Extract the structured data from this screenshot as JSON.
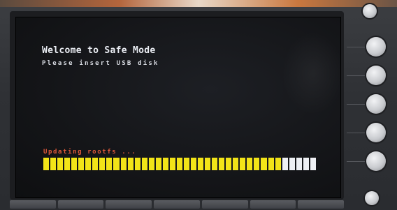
{
  "screen": {
    "title": "Welcome to Safe Mode",
    "message": "Please insert USB disk",
    "status": "Updating rootfs ..."
  },
  "progress": {
    "total_segments": 39,
    "filled_segments": 34,
    "fraction": 0.87,
    "filled_color": "#f2e418",
    "empty_color": "#eef0f4"
  },
  "colors": {
    "title_text": "#e9ecf2",
    "status_text": "#e0593a",
    "screen_bg": "#141518"
  },
  "hardware": {
    "softkeys": [
      "softkey-1",
      "softkey-2",
      "softkey-3",
      "softkey-4",
      "softkey-5"
    ],
    "bottom_keys": 7
  }
}
